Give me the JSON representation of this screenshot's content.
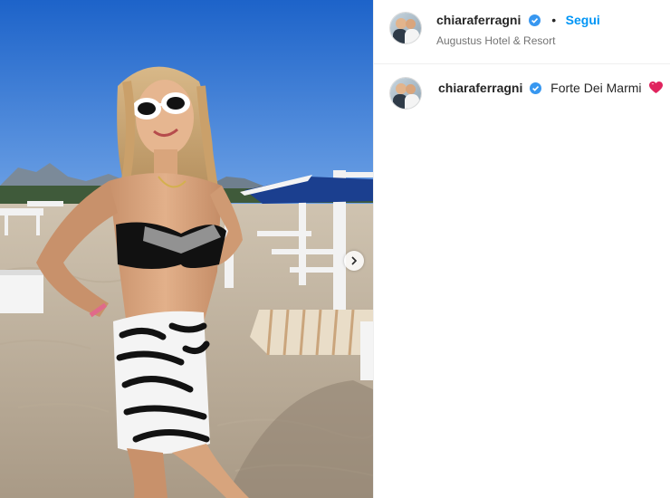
{
  "post": {
    "username": "chiaraferragni",
    "separator": "•",
    "follow_label": "Segui",
    "location": "Augustus Hotel & Resort",
    "caption_username": "chiaraferragni",
    "caption_text": "Forte Dei Marmi",
    "caption_emoji": "heart-emoji"
  },
  "icons": {
    "verified": "verified-badge-icon",
    "next": "chevron-right-icon"
  },
  "colors": {
    "link_blue": "#0095f6",
    "verified_blue": "#3797f0",
    "text": "#262626",
    "muted": "#737373",
    "heart": "#e0245e"
  }
}
